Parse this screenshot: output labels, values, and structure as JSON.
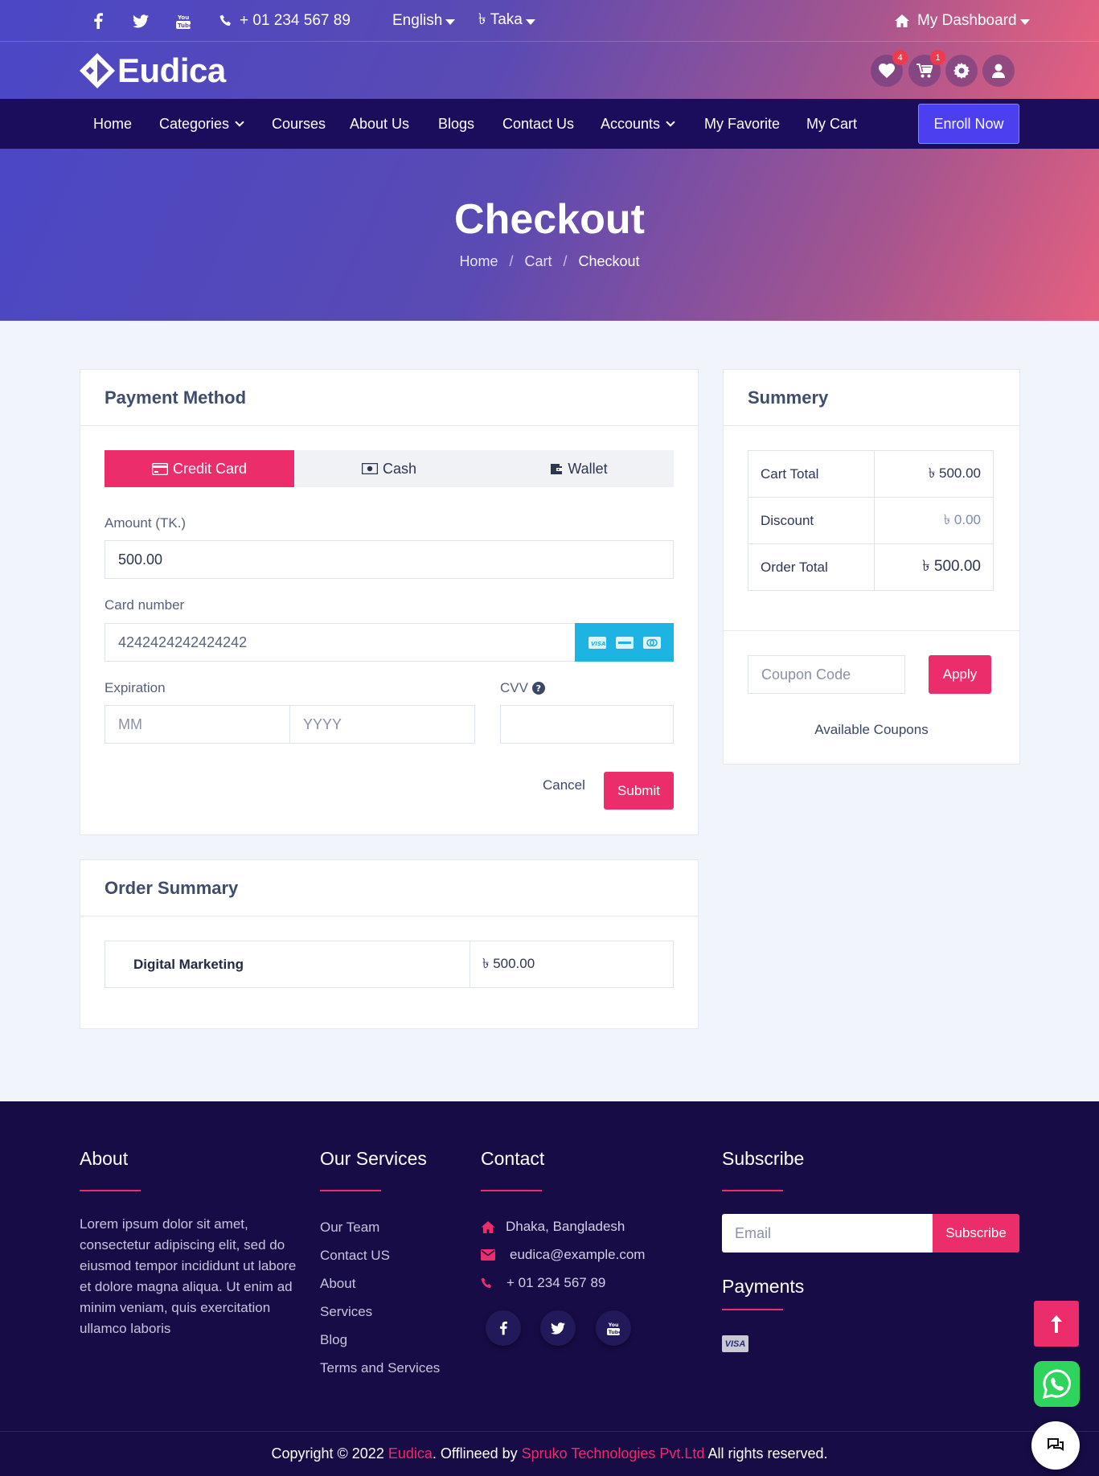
{
  "topbar": {
    "phone": "+ 01 234 567 89",
    "language": "English",
    "currency": "৳ Taka",
    "dashboard": "My Dashboard"
  },
  "header": {
    "logo_text": "Eudica",
    "wishlist_count": "4",
    "cart_count": "1"
  },
  "nav": {
    "items": [
      "Home",
      "Categories",
      "Courses",
      "About Us",
      "Blogs",
      "Contact Us",
      "Accounts",
      "My Favorite",
      "My Cart"
    ],
    "enroll": "Enroll Now"
  },
  "hero": {
    "title": "Checkout",
    "breadcrumb": [
      "Home",
      "Cart",
      "Checkout"
    ]
  },
  "payment": {
    "title": "Payment Method",
    "tabs": [
      "Credit Card",
      "Cash",
      "Wallet"
    ],
    "amount_label": "Amount (TK.)",
    "amount_value": "500.00",
    "card_label": "Card number",
    "card_value": "4242424242424242",
    "expiration_label": "Expiration",
    "mm_placeholder": "MM",
    "yyyy_placeholder": "YYYY",
    "cvv_label": "CVV",
    "cancel": "Cancel",
    "submit": "Submit"
  },
  "summary": {
    "title": "Summery",
    "rows": [
      {
        "label": "Cart Total",
        "value": "৳ 500.00"
      },
      {
        "label": "Discount",
        "value": "৳ 0.00"
      },
      {
        "label": "Order Total",
        "value": "৳ 500.00"
      }
    ],
    "coupon_placeholder": "Coupon Code",
    "apply": "Apply",
    "available": "Available Coupons"
  },
  "order_summary": {
    "title": "Order Summary",
    "item_name": "Digital Marketing",
    "item_price": "৳ 500.00"
  },
  "footer": {
    "about_title": "About",
    "about_text": "Lorem ipsum dolor sit amet, consectetur adipiscing elit, sed do eiusmod tempor incididunt ut labore et dolore magna aliqua. Ut enim ad minim veniam, quis exercitation ullamco laboris",
    "services_title": "Our Services",
    "services": [
      "Our Team",
      "Contact US",
      "About",
      "Services",
      "Blog",
      "Terms and Services"
    ],
    "contact_title": "Contact",
    "address": "Dhaka, Bangladesh",
    "email": "eudica@example.com",
    "phone": "+ 01 234 567 89",
    "subscribe_title": "Subscribe",
    "email_placeholder": "Email",
    "subscribe_btn": "Subscribe",
    "payments_title": "Payments",
    "visa": "VISA",
    "copy_prefix": "Copyright © 2022 ",
    "copy_brand": "Eudica",
    "copy_mid": ". Offlineed by ",
    "copy_company": "Spruko Technologies Pvt.Ltd",
    "copy_suffix": " All rights reserved."
  },
  "colors": {
    "accent": "#eb2d6c",
    "nav_bg": "#1c0d5c",
    "footer_bg": "#170c45",
    "enroll_bg": "#4b3ff0",
    "card_icons_bg": "#1db4e3"
  }
}
